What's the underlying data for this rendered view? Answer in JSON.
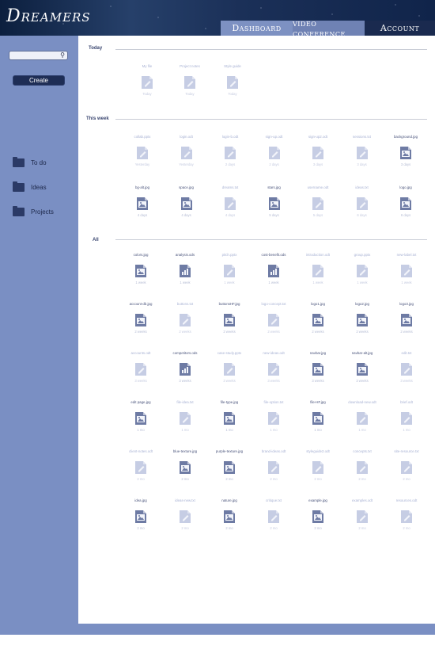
{
  "header": {
    "logo": "Dreamers",
    "tabs": [
      {
        "label": "Dashboard",
        "key": "dashboard"
      },
      {
        "label": "video conference",
        "key": "video"
      },
      {
        "label": "Account",
        "key": "account"
      }
    ]
  },
  "sidebar": {
    "search_placeholder": "",
    "create_label": "Create",
    "items": [
      {
        "label": "To do"
      },
      {
        "label": "Ideas"
      },
      {
        "label": "Projects"
      }
    ]
  },
  "sections": [
    {
      "label": "Today"
    },
    {
      "label": "This week"
    },
    {
      "label": "All"
    }
  ],
  "today_files": [
    {
      "name": "My file",
      "date": "Today",
      "type": "doc"
    },
    {
      "name": "Project notes",
      "date": "Today",
      "type": "doc"
    },
    {
      "name": "Style guide",
      "date": "Today",
      "type": "doc"
    }
  ],
  "week_files": [
    {
      "name": "collab.pptx",
      "date": "Yesterday",
      "type": "doc",
      "strong": false
    },
    {
      "name": "login.odt",
      "date": "Yesterday",
      "type": "doc",
      "strong": false
    },
    {
      "name": "login-b.odt",
      "date": "2 days",
      "type": "doc",
      "strong": false
    },
    {
      "name": "sign-up.odt",
      "date": "2 days",
      "type": "doc",
      "strong": false
    },
    {
      "name": "sign-up2.odt",
      "date": "3 days",
      "type": "doc",
      "strong": false
    },
    {
      "name": "sessions.txt",
      "date": "3 days",
      "type": "doc",
      "strong": false
    },
    {
      "name": "background.jpg",
      "date": "3 days",
      "type": "img",
      "strong": true
    },
    {
      "name": "bg-alt.jpg",
      "date": "4 days",
      "type": "img",
      "strong": true
    },
    {
      "name": "space.jpg",
      "date": "4 days",
      "type": "img",
      "strong": true
    },
    {
      "name": "dreams.txt",
      "date": "4 days",
      "type": "doc",
      "strong": false
    },
    {
      "name": "stars.jpg",
      "date": "5 days",
      "type": "img",
      "strong": true
    },
    {
      "name": "username.odt",
      "date": "5 days",
      "type": "doc",
      "strong": false
    },
    {
      "name": "ideas.txt",
      "date": "6 days",
      "type": "doc",
      "strong": false
    },
    {
      "name": "logo.jpg",
      "date": "6 days",
      "type": "img",
      "strong": true
    }
  ],
  "all_files": [
    {
      "name": "colors.jpg",
      "date": "1 week",
      "type": "img",
      "strong": true
    },
    {
      "name": "analysis.ods",
      "date": "1 week",
      "type": "sheet",
      "strong": true
    },
    {
      "name": "pitch.pptx",
      "date": "1 week",
      "type": "doc",
      "strong": false
    },
    {
      "name": "cost-benefit.ods",
      "date": "1 week",
      "type": "sheet",
      "strong": true
    },
    {
      "name": "introduction.odt",
      "date": "1 week",
      "type": "doc",
      "strong": false
    },
    {
      "name": "group.pptx",
      "date": "1 week",
      "type": "doc",
      "strong": false
    },
    {
      "name": "new-label.txt",
      "date": "1 week",
      "type": "doc",
      "strong": false
    },
    {
      "name": "account-db.jpg",
      "date": "2 weeks",
      "type": "img",
      "strong": true
    },
    {
      "name": "buttons.txt",
      "date": "2 weeks",
      "type": "doc",
      "strong": false
    },
    {
      "name": "buttonsHF.jpg",
      "date": "2 weeks",
      "type": "img",
      "strong": true
    },
    {
      "name": "logo-concept.txt",
      "date": "2 weeks",
      "type": "doc",
      "strong": false
    },
    {
      "name": "logo1.jpg",
      "date": "2 weeks",
      "type": "img",
      "strong": true
    },
    {
      "name": "logo2.jpg",
      "date": "2 weeks",
      "type": "img",
      "strong": true
    },
    {
      "name": "logo3.jpg",
      "date": "2 weeks",
      "type": "img",
      "strong": true
    },
    {
      "name": "accounts.odt",
      "date": "3 weeks",
      "type": "doc",
      "strong": false
    },
    {
      "name": "competitors.ods",
      "date": "3 weeks",
      "type": "sheet",
      "strong": true
    },
    {
      "name": "case-study.pptx",
      "date": "3 weeks",
      "type": "doc",
      "strong": false
    },
    {
      "name": "new-ideas.odt",
      "date": "3 weeks",
      "type": "doc",
      "strong": false
    },
    {
      "name": "navbar.jpg",
      "date": "3 weeks",
      "type": "img",
      "strong": true
    },
    {
      "name": "navbar-alt.jpg",
      "date": "3 weeks",
      "type": "img",
      "strong": true
    },
    {
      "name": "edit.txt",
      "date": "3 weeks",
      "type": "doc",
      "strong": false
    },
    {
      "name": "edit page.jpg",
      "date": "1 mo",
      "type": "img",
      "strong": true
    },
    {
      "name": "file-idea.txt",
      "date": "1 mo",
      "type": "doc",
      "strong": false
    },
    {
      "name": "file-type.jpg",
      "date": "1 mo",
      "type": "img",
      "strong": true
    },
    {
      "name": "file-option.txt",
      "date": "1 mo",
      "type": "doc",
      "strong": false
    },
    {
      "name": "file-HF.jpg",
      "date": "1 mo",
      "type": "img",
      "strong": true
    },
    {
      "name": "download-new.odt",
      "date": "1 mo",
      "type": "doc",
      "strong": false
    },
    {
      "name": "brief.odt",
      "date": "1 mo",
      "type": "doc",
      "strong": false
    },
    {
      "name": "client-notes.odt",
      "date": "2 mo",
      "type": "doc",
      "strong": false
    },
    {
      "name": "blue-texture.jpg",
      "date": "2 mo",
      "type": "img",
      "strong": true
    },
    {
      "name": "purple-texture.jpg",
      "date": "2 mo",
      "type": "img",
      "strong": true
    },
    {
      "name": "brand-ideas.odt",
      "date": "2 mo",
      "type": "doc",
      "strong": false
    },
    {
      "name": "styleguide2.odt",
      "date": "2 mo",
      "type": "doc",
      "strong": false
    },
    {
      "name": "concepts.txt",
      "date": "2 mo",
      "type": "doc",
      "strong": false
    },
    {
      "name": "site-resource.txt",
      "date": "2 mo",
      "type": "doc",
      "strong": false
    },
    {
      "name": "idea.jpg",
      "date": "2 mo",
      "type": "img",
      "strong": true
    },
    {
      "name": "ideas-new.txt",
      "date": "2 mo",
      "type": "doc",
      "strong": false
    },
    {
      "name": "nature.jpg",
      "date": "2 mo",
      "type": "img",
      "strong": true
    },
    {
      "name": "critique.txt",
      "date": "2 mo",
      "type": "doc",
      "strong": false
    },
    {
      "name": "example.jpg",
      "date": "2 mo",
      "type": "img",
      "strong": true
    },
    {
      "name": "examples.odt",
      "date": "2 mo",
      "type": "doc",
      "strong": false
    },
    {
      "name": "resources.odt",
      "date": "2 mo",
      "type": "doc",
      "strong": false
    }
  ],
  "colors": {
    "sidebar": "#7a8fc3",
    "dark_navy": "#1e2d55",
    "file_label": "#a7b1d3"
  }
}
